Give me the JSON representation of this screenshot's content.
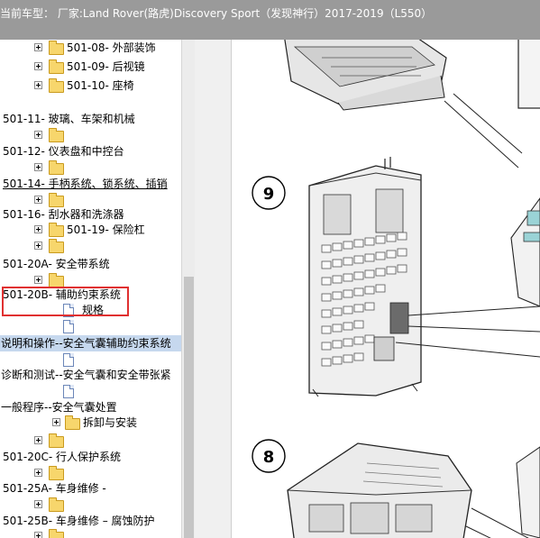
{
  "title_bar": {
    "text": "当前车型：  厂家:Land Rover(路虎)Discovery Sport（发现神行）2017-2019（L550）"
  },
  "tree": {
    "items": [
      {
        "label": "501-08- 外部装饰"
      },
      {
        "label": "501-09- 后视镜"
      },
      {
        "label": "501-10- 座椅"
      },
      {
        "label": "501-11- 玻璃、车架和机械"
      },
      {
        "label": ""
      },
      {
        "label": "501-12- 仪表盘和中控台"
      },
      {
        "label": ""
      },
      {
        "label": "501-14- 手柄系统、锁系统、插销"
      },
      {
        "label": ""
      },
      {
        "label": "501-16- 刮水器和洗涤器"
      },
      {
        "label": "501-19- 保险杠"
      },
      {
        "label": ""
      },
      {
        "label": "501-20A- 安全带系统"
      },
      {
        "label": ""
      },
      {
        "label": "501-20B- 辅助约束系统"
      },
      {
        "label": "规格"
      },
      {
        "label": ""
      },
      {
        "label": "说明和操作--安全气囊辅助约束系统"
      },
      {
        "label": ""
      },
      {
        "label": "诊断和测试--安全气囊和安全带张紧"
      },
      {
        "label": ""
      },
      {
        "label": "一般程序--安全气囊处置"
      },
      {
        "label": "拆卸与安装"
      },
      {
        "label": ""
      },
      {
        "label": "501-20C- 行人保护系统"
      },
      {
        "label": ""
      },
      {
        "label": "501-25A- 车身维修 -"
      },
      {
        "label": ""
      },
      {
        "label": "501-25B- 车身维修 – 腐蚀防护"
      },
      {
        "label": ""
      }
    ]
  },
  "diagram": {
    "callouts": [
      "9",
      "8"
    ]
  },
  "colors": {
    "title_bg": "#9a9a9a",
    "highlight_red": "#e03030",
    "selected_row": "#c6d8ee"
  }
}
